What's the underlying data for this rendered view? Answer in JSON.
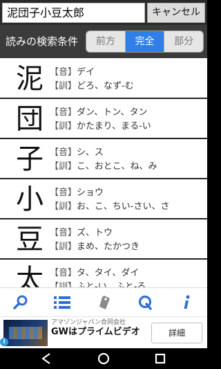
{
  "search": {
    "value": "泥団子小豆太郎"
  },
  "cancel_label": "キャンセル",
  "conditions": {
    "label": "読みの検索条件",
    "options": [
      "前方",
      "完全",
      "部分"
    ],
    "selected": "完全"
  },
  "results": [
    {
      "kanji": "泥",
      "on_tag": "【音】",
      "on": "デイ",
      "kun_tag": "【訓】",
      "kun": "どろ、なず-む"
    },
    {
      "kanji": "団",
      "on_tag": "【音】",
      "on": "ダン、トン、タン",
      "kun_tag": "【訓】",
      "kun": "かたまり、まる-い"
    },
    {
      "kanji": "子",
      "on_tag": "【音】",
      "on": "シ、ス",
      "kun_tag": "【訓】",
      "kun": "こ、おとこ、ね、み"
    },
    {
      "kanji": "小",
      "on_tag": "【音】",
      "on": "ショウ",
      "kun_tag": "【訓】",
      "kun": "お、こ、ちい-さい、さ"
    },
    {
      "kanji": "豆",
      "on_tag": "【音】",
      "on": "ズ、トウ",
      "kun_tag": "【訓】",
      "kun": "まめ、たかつき"
    },
    {
      "kanji": "太",
      "on_tag": "【音】",
      "on": "タ、タイ、ダイ",
      "kun_tag": "【訓】",
      "kun": "ふと-い、ふと-る"
    }
  ],
  "tabs": [
    {
      "icon": "search-icon"
    },
    {
      "icon": "list-icon"
    },
    {
      "icon": "tag-icon"
    },
    {
      "icon": "q-icon"
    },
    {
      "icon": "info-icon"
    }
  ],
  "ad": {
    "advertiser": "アマゾンジャパン合同会社",
    "headline": "GWはプライムビデオ",
    "cta": "詳細"
  },
  "colors": {
    "accent": "#2f7fe6",
    "tab_icon": "#2f6fd6"
  }
}
